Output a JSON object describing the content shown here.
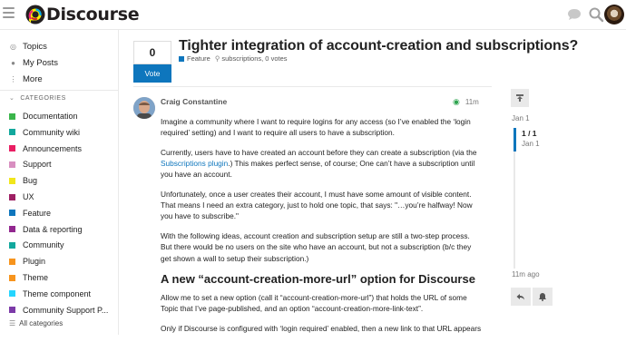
{
  "header": {
    "logo_text": "Discourse",
    "icons": [
      "menu-icon",
      "chat-bubble-icon",
      "search-icon",
      "hamburger-icon",
      "user-avatar"
    ]
  },
  "sidebar": {
    "top_items": [
      {
        "label": "Topics",
        "icon": "topics-icon"
      },
      {
        "label": "My Posts",
        "icon": "user-icon"
      },
      {
        "label": "More",
        "icon": "more-vertical-icon"
      }
    ],
    "categories_header": "CATEGORIES",
    "categories": [
      {
        "label": "Documentation",
        "color": "#3ab54a"
      },
      {
        "label": "Community wiki",
        "color": "#12a89d"
      },
      {
        "label": "Announcements",
        "color": "#e91e63"
      },
      {
        "label": "Support",
        "color": "#d88fc0"
      },
      {
        "label": "Bug",
        "color": "#f1e61b"
      },
      {
        "label": "UX",
        "color": "#9e1f63"
      },
      {
        "label": "Feature",
        "color": "#0e76bd"
      },
      {
        "label": "Data & reporting",
        "color": "#92278f"
      },
      {
        "label": "Community",
        "color": "#12a89d"
      },
      {
        "label": "Plugin",
        "color": "#f7941d"
      },
      {
        "label": "Theme",
        "color": "#f7941d"
      },
      {
        "label": "Theme component",
        "color": "#25d5ff"
      },
      {
        "label": "Community Support P...",
        "color": "#7c3aa8"
      }
    ],
    "all_categories": "All categories"
  },
  "topic": {
    "vote_count": "0",
    "vote_label": "Vote",
    "title": "Tighter integration of account-creation and subscriptions?",
    "category": "Feature",
    "tag": "subscriptions",
    "votes_text": ", 0 votes"
  },
  "post": {
    "author": "Craig Constantine",
    "time": "11m",
    "p1": "Imagine a community where I want to require logins for any access (so I’ve enabled the ‘login required’ setting) and I want to require all users to have a subscription.",
    "p2_a": "Currently, users have to have created an account before they can create a subscription (via the ",
    "p2_link": "Subscriptions plugin",
    "p2_b": ".) This makes perfect sense, of course; One can’t have a subscription until you have an account.",
    "p3": "Unfortunately, once a user creates their account, I must have some amount of visible content. That means I need an extra category, just to hold one topic, that says: \"…you’re halfway! Now you have to subscribe.\"",
    "p4": "With the following ideas, account creation and subscription setup are still a two-step process. But there would be no users on the site who have an account, but not a subscription (b/c they get shown a wall to setup their subscription.)",
    "h2": "A new “account-creation-more-url” option for Discourse",
    "p5": "Allow me to set a new option (call it “account-creation-more-url”) that holds the URL of some Topic that I’ve page-published, and an option “account-creation-more-link-text”.",
    "p6": "Only if Discourse is configured with ‘login required’ enabled, then a new link to that URL appears"
  },
  "timeline": {
    "start_date": "Jan 1",
    "position": "1 / 1",
    "position_date": "Jan 1",
    "end_label": "11m ago"
  }
}
